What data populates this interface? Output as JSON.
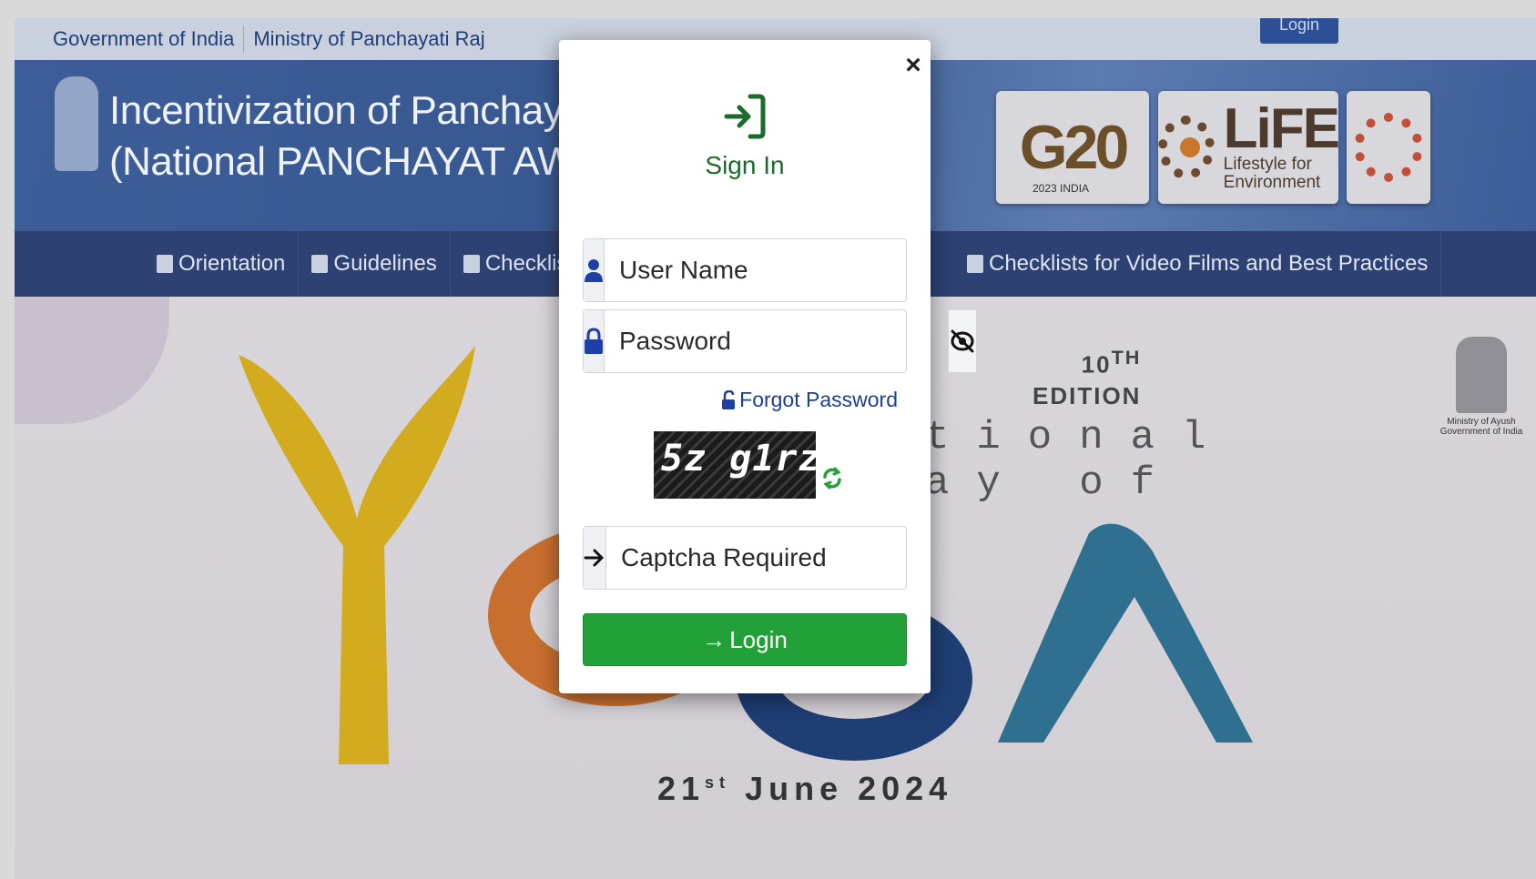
{
  "gov_strip": {
    "government": "Government of India",
    "ministry": "Ministry of Panchayati Raj",
    "login_tab": "Login"
  },
  "banner": {
    "title_line1": "Incentivization of Panchayats",
    "title_line2": "(National PANCHAYAT AWARDS",
    "logo_g20": "G20",
    "logo_g20_sub": "2023 INDIA",
    "logo_life": "LiFE",
    "logo_life_sub1": "Lifestyle for",
    "logo_life_sub2": "Environment"
  },
  "nav": {
    "items": [
      {
        "label": "Orientation",
        "icon": "document-icon"
      },
      {
        "label": "Guidelines",
        "icon": "list-icon"
      },
      {
        "label": "Checklist",
        "icon": "list-icon"
      }
    ],
    "video_item": {
      "label": "Checklists for Video Films and Best Practices",
      "icon": "video-icon"
    }
  },
  "hero": {
    "edition_number": "10",
    "edition_sup": "TH",
    "edition_word": "EDITION",
    "intl_line1": "tional",
    "intl_line2": "ay of",
    "date_day": "21",
    "date_sup": "st",
    "date_rest": "June 2024",
    "ministry_line1": "Ministry of Ayush",
    "ministry_line2": "Government of India"
  },
  "modal": {
    "title": "Sign In",
    "close_label": "×",
    "username_placeholder": "User Name",
    "password_placeholder": "Password",
    "forgot_password": "Forgot Password",
    "captcha_text": "5z g1rz",
    "captcha_placeholder": "Captcha Required",
    "login_label": "Login",
    "colors": {
      "title": "#1b6b2a",
      "login_button": "#22a138",
      "link": "#1b3f97",
      "icon_blue": "#1e3fa8"
    }
  }
}
